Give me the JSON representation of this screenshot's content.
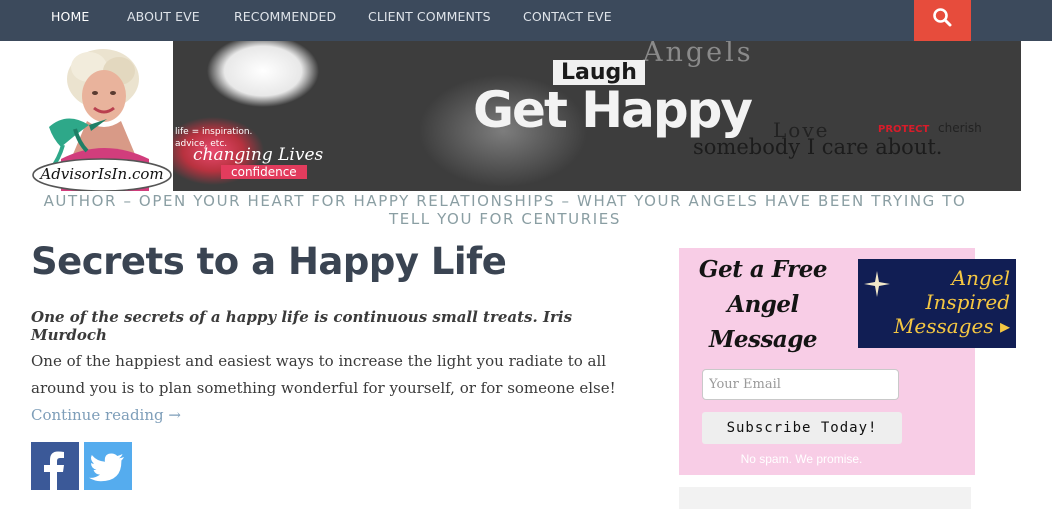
{
  "nav": {
    "items": [
      {
        "label": "HOME"
      },
      {
        "label": "ABOUT EVE"
      },
      {
        "label": "RECOMMENDED"
      },
      {
        "label": "CLIENT COMMENTS"
      },
      {
        "label": "CONTACT EVE"
      }
    ]
  },
  "header": {
    "logo_text": "AdvisorIsIn.com",
    "collage": {
      "angels": "Angels",
      "laugh": "Laugh",
      "get_happy": "Get Happy",
      "love": "Love",
      "protect": "PROTECT",
      "cherish": "cherish",
      "somebody": "somebody I care about.",
      "changing": "changing Lives",
      "confidence": "confidence",
      "inspiration": "life = inspiration.",
      "advice": "advice, etc."
    },
    "tagline": "AUTHOR – OPEN YOUR HEART FOR HAPPY RELATIONSHIPS – WHAT YOUR ANGELS HAVE BEEN TRYING TO TELL YOU FOR CENTURIES"
  },
  "post": {
    "title": "Secrets to a Happy Life",
    "quote": "One of the secrets of a happy life is continuous small treats. Iris Murdoch",
    "body": "One of the happiest and easiest ways to increase the light you radiate to all around you is to plan something wonderful for yourself, or for someone else! ",
    "continue": "Continue reading →"
  },
  "widget": {
    "heading_line1": "Get a Free",
    "heading_line2": "Angel",
    "heading_line3": "Message",
    "angel_line1": "Angel",
    "angel_line2": "Inspired",
    "angel_line3": "Messages ▸",
    "email_placeholder": "Your Email",
    "subscribe_label": "Subscribe Today!",
    "nospam": "No spam. We promise."
  },
  "colors": {
    "nav_bg": "#3c4a5c",
    "search_bg": "#e74c3c",
    "title": "#3a4452",
    "tagline": "#8a9ea3",
    "link": "#7e9eb9",
    "widget_bg": "#f8cde6",
    "facebook": "#3b5998",
    "twitter": "#55acee"
  }
}
